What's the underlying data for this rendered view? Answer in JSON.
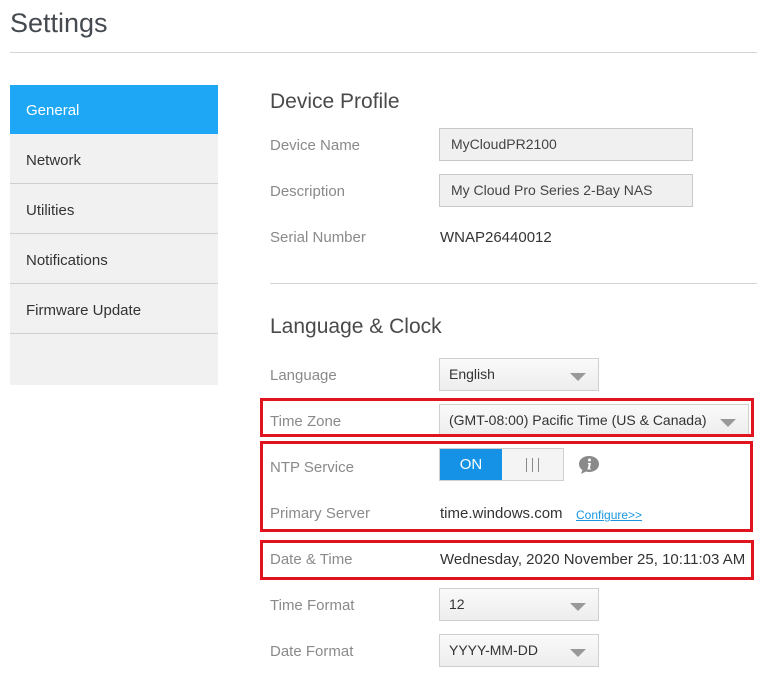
{
  "page": {
    "title": "Settings"
  },
  "sidebar": {
    "items": [
      {
        "label": "General",
        "active": true
      },
      {
        "label": "Network",
        "active": false
      },
      {
        "label": "Utilities",
        "active": false
      },
      {
        "label": "Notifications",
        "active": false
      },
      {
        "label": "Firmware Update",
        "active": false
      }
    ]
  },
  "device_profile": {
    "title": "Device Profile",
    "device_name": {
      "label": "Device Name",
      "value": "MyCloudPR2100"
    },
    "description": {
      "label": "Description",
      "value": "My Cloud Pro Series 2-Bay NAS"
    },
    "serial_number": {
      "label": "Serial Number",
      "value": "WNAP26440012"
    }
  },
  "language_clock": {
    "title": "Language & Clock",
    "language": {
      "label": "Language",
      "value": "English"
    },
    "time_zone": {
      "label": "Time Zone",
      "value": "(GMT-08:00) Pacific Time (US & Canada)"
    },
    "ntp_service": {
      "label": "NTP Service",
      "state": "ON"
    },
    "primary_server": {
      "label": "Primary Server",
      "value": "time.windows.com",
      "link": "Configure>>"
    },
    "date_time": {
      "label": "Date & Time",
      "value": "Wednesday, 2020 November 25, 10:11:03 AM"
    },
    "time_format": {
      "label": "Time Format",
      "value": "12"
    },
    "date_format": {
      "label": "Date Format",
      "value": "YYYY-MM-DD"
    }
  },
  "colors": {
    "accent": "#1ea7f4",
    "toggle_on": "#1591e6",
    "highlight": "#e0141e",
    "link": "#1a96e0"
  },
  "icons": [
    "chevron-down-icon",
    "info-icon"
  ]
}
